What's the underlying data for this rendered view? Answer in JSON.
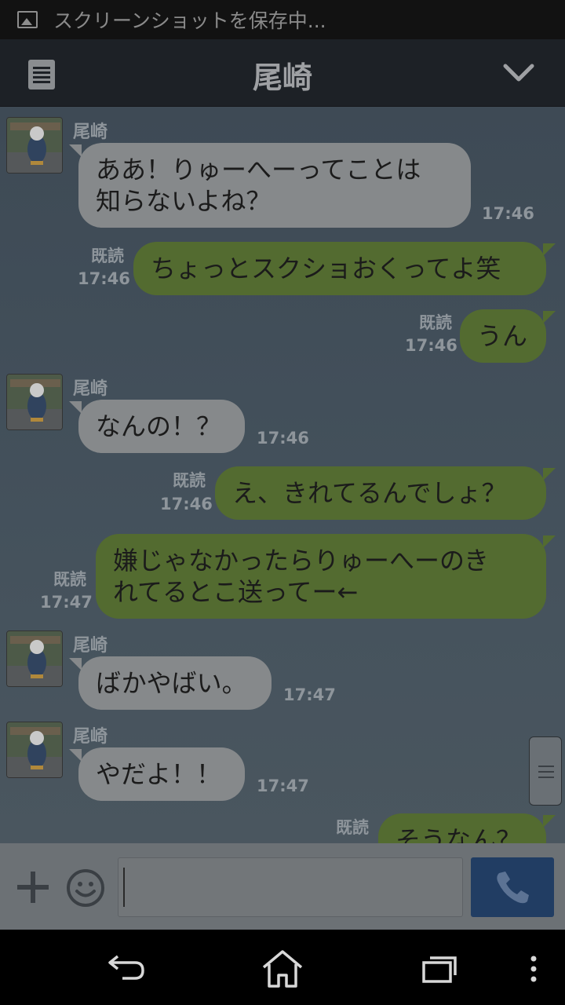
{
  "status_bar": {
    "text": "スクリーンショットを保存中..."
  },
  "header": {
    "title": "尾崎"
  },
  "messages": [
    {
      "type": "in",
      "sender": "尾崎",
      "lines": [
        "ああ！りゅーへーってことは",
        "知らないよね？"
      ],
      "time": "17:46"
    },
    {
      "type": "out",
      "read": "既読",
      "time": "17:46",
      "text": "ちょっとスクショおくってよ笑"
    },
    {
      "type": "out",
      "read": "既読",
      "time": "17:46",
      "text": "うん"
    },
    {
      "type": "in",
      "sender": "尾崎",
      "text": "なんの！？",
      "time": "17:46"
    },
    {
      "type": "out",
      "read": "既読",
      "time": "17:46",
      "text": "え、きれてるんでしょ？"
    },
    {
      "type": "out",
      "read": "既読",
      "time": "17:47",
      "lines": [
        "嫌じゃなかったらりゅーへーのき",
        "れてるとこ送ってー←"
      ]
    },
    {
      "type": "in",
      "sender": "尾崎",
      "text": "ばかやばい。",
      "time": "17:47"
    },
    {
      "type": "in",
      "sender": "尾崎",
      "text": "やだよ！！",
      "time": "17:47"
    },
    {
      "type": "out",
      "read": "既読",
      "text": "そうなん？"
    }
  ],
  "input": {
    "placeholder": ""
  },
  "colors": {
    "incoming_bubble": "#86898b",
    "outgoing_bubble": "#536b30",
    "call_button": "#213d63"
  }
}
